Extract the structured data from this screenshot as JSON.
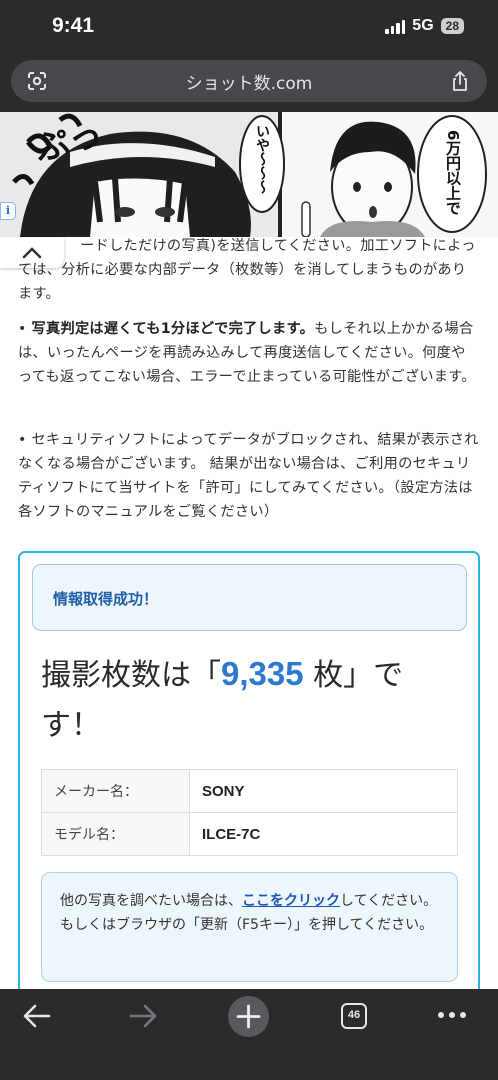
{
  "status_bar": {
    "time": "9:41",
    "network": "5G",
    "battery": "28"
  },
  "browser": {
    "url": "ショット数.com",
    "tab_count": "46"
  },
  "article": {
    "para1_partial": "ードしただけの写真)を送信してください。加工ソフトによっては、分析に必要な内部データ（枚数等）を消してしまうものがあります。",
    "bullet2_bold": "写真判定は遅くても1分ほどで完了します。",
    "bullet2_rest": "もしそれ以上かかる場合は、いったんページを再読み込みして再度送信してください。何度やっても返ってこない場合、エラーで止まっている可能性がございます。",
    "bullet3": "セキュリティソフトによってデータがブロックされ、結果が表示されなくなる場合がございます。 結果が出ない場合は、ご利用のセキュリティソフトにて当サイトを「許可」にしてみてください。（設定方法は各ソフトのマニュアルをご覧ください）"
  },
  "result": {
    "alert": "情報取得成功！",
    "headline_prefix": "撮影枚数は「",
    "shot_count": "9,335",
    "headline_suffix": " 枚」です！",
    "table": [
      {
        "key": "メーカー名：",
        "value": "SONY"
      },
      {
        "key": "モデル名：",
        "value": "ILCE-7C"
      }
    ],
    "note_before": "他の写真を調べたい場合は、",
    "note_link": "ここをクリック",
    "note_after": "してください。もしくはブラウザの「更新（F5キー）」を押してください。"
  },
  "ad": {
    "speech_1": "いや〜〜〜",
    "speech_2": "6万円以上で",
    "sfx": "ぷっ"
  },
  "colors": {
    "accent": "#2d78d0",
    "box_border": "#2bb3e6",
    "alert_bg": "#eef5fd"
  }
}
